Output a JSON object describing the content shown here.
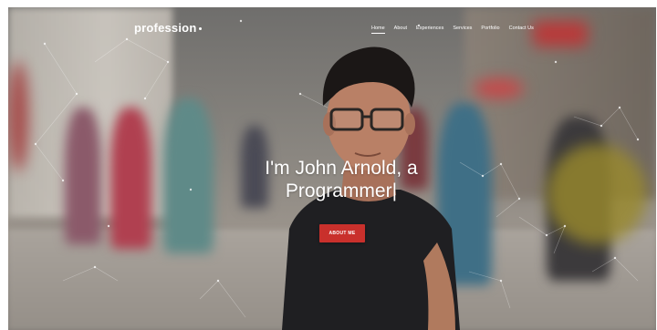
{
  "site": {
    "logo_text": "profession"
  },
  "nav": {
    "items": [
      {
        "label": "Home",
        "active": true
      },
      {
        "label": "About",
        "active": false
      },
      {
        "label": "Experiences",
        "active": false
      },
      {
        "label": "Services",
        "active": false
      },
      {
        "label": "Portfolio",
        "active": false
      },
      {
        "label": "Contact Us",
        "active": false
      }
    ]
  },
  "hero": {
    "headline_line1": "I'm John Arnold, a",
    "headline_line2": "Programmer",
    "caret": "|",
    "cta_label": "ABOUT ME"
  },
  "colors": {
    "accent": "#c9302c",
    "text": "#ffffff"
  }
}
